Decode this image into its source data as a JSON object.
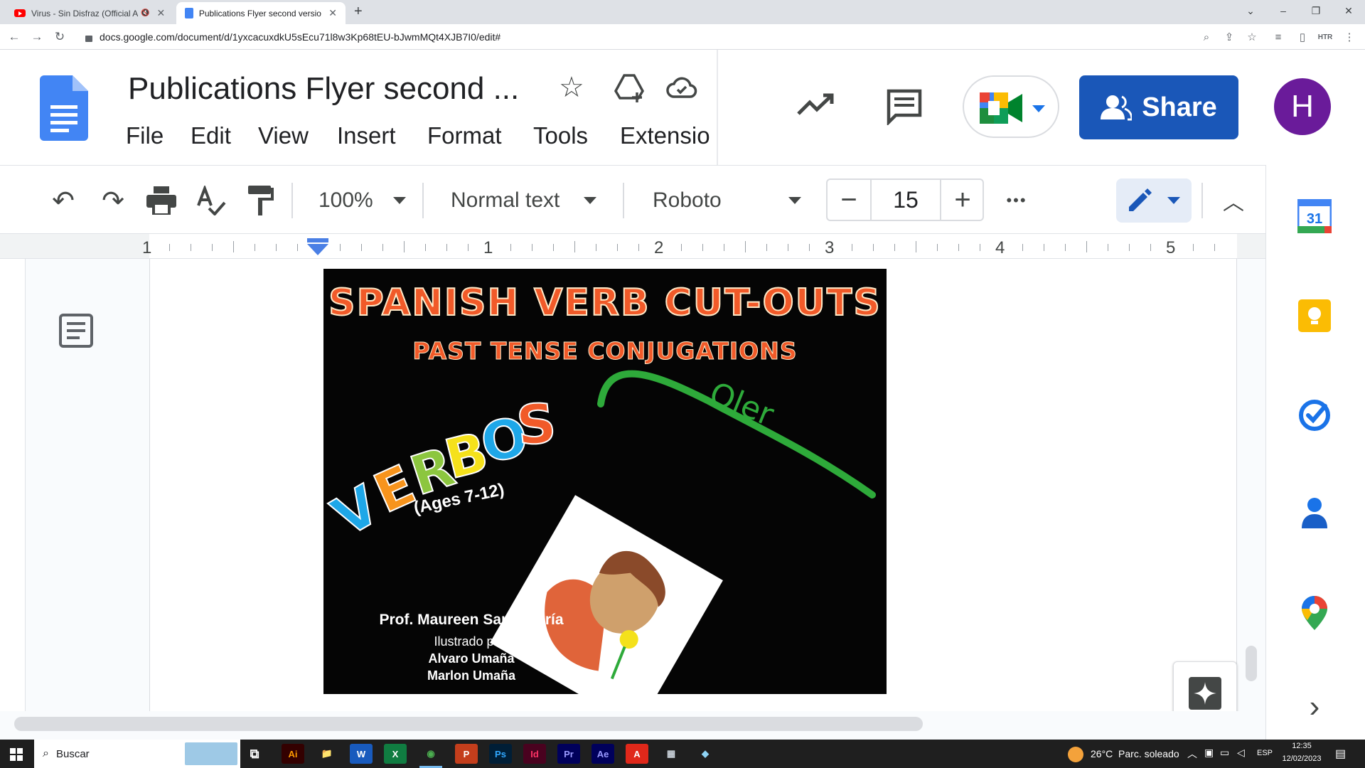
{
  "browser": {
    "tabs": [
      {
        "label": "Virus - Sin Disfraz (Official A",
        "close": "✕",
        "mute": "🔇"
      },
      {
        "label": "Publications Flyer second version",
        "close": "✕"
      }
    ],
    "new_tab": "+",
    "window_controls": {
      "minimize": "–",
      "maximize": "❐",
      "close": "✕",
      "list": "⌄"
    },
    "url": "docs.google.com/document/d/1yxcacuxdkU5sEcu71l8w3Kp68tEU-bJwmMQt4XJB7I0/edit#",
    "nav": {
      "back": "←",
      "forward": "→",
      "reload": "↻"
    },
    "omni_extra": "HTR"
  },
  "docs": {
    "title": "Publications Flyer second ...",
    "menu": [
      "File",
      "Edit",
      "View",
      "Insert",
      "Format",
      "Tools",
      "Extensio"
    ],
    "share_label": "Share",
    "avatar_letter": "H",
    "toolbar": {
      "zoom": "100%",
      "style": "Normal text",
      "font": "Roboto",
      "font_size": "15",
      "minus": "−",
      "plus": "+",
      "more": "•••"
    },
    "ruler_numbers": [
      "1",
      "1",
      "2",
      "3",
      "4",
      "5"
    ]
  },
  "flyer": {
    "title": "SPANISH VERB CUT-OUTS",
    "subtitle": "PAST TENSE CONJUGATIONS",
    "verbos_letters": [
      "V",
      "E",
      "R",
      "B",
      "O",
      "S"
    ],
    "verbos_colors": [
      "#1ea7e8",
      "#f7941d",
      "#8cc63f",
      "#f5e11b",
      "#1ea7e8",
      "#f15a29"
    ],
    "ages": "(Ages 7-12)",
    "verb_word": "Oler",
    "author": "Prof. Maureen Santamaría",
    "illustrated_by": "Ilustrado por:",
    "illustrator_1": "Alvaro Umaña",
    "illustrator_2": "Marlon Umaña"
  },
  "sidepanel": {
    "calendar_day": "31",
    "expand": "›"
  },
  "taskbar": {
    "search_placeholder": "Buscar",
    "apps": [
      {
        "label": "Ai",
        "bg": "#330000",
        "fg": "#ff9a00"
      },
      {
        "label": "📁",
        "bg": "transparent",
        "fg": "#f8c640"
      },
      {
        "label": "W",
        "bg": "#185abd",
        "fg": "#ffffff"
      },
      {
        "label": "X",
        "bg": "#107c41",
        "fg": "#ffffff"
      },
      {
        "label": "◉",
        "bg": "transparent",
        "fg": "#4caf50"
      },
      {
        "label": "P",
        "bg": "#c43e1c",
        "fg": "#ffffff"
      },
      {
        "label": "Ps",
        "bg": "#001e36",
        "fg": "#31a8ff"
      },
      {
        "label": "Id",
        "bg": "#49021f",
        "fg": "#ff3366"
      },
      {
        "label": "Pr",
        "bg": "#00005b",
        "fg": "#9999ff"
      },
      {
        "label": "Ae",
        "bg": "#00005b",
        "fg": "#9999ff"
      },
      {
        "label": "A",
        "bg": "#e0281a",
        "fg": "#ffffff"
      },
      {
        "label": "▦",
        "bg": "transparent",
        "fg": "#c9d1d9"
      },
      {
        "label": "◆",
        "bg": "transparent",
        "fg": "#8fd4f5"
      }
    ],
    "weather": "26°C  Parc. soleado",
    "language": "ESP",
    "time": "12:35",
    "date": "12/02/2023"
  },
  "colors": {
    "share_button": "#1a57b8",
    "avatar": "#6a1b9a",
    "docs_blue": "#4285f4",
    "ruler_marker": "#4a7fe5"
  }
}
